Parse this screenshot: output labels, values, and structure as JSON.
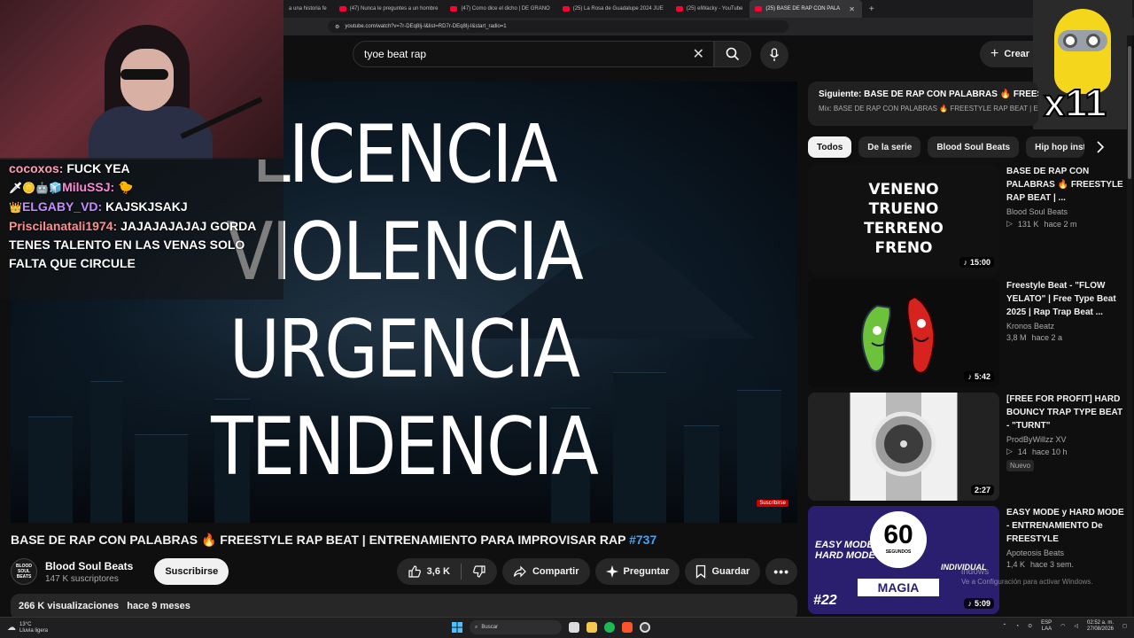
{
  "browser": {
    "tabs": [
      {
        "label": "a una historia fe"
      },
      {
        "label": "(47) Nunca le preguntes a un hombre"
      },
      {
        "label": "(47) Como dice el dicho | DE GRANO"
      },
      {
        "label": "(25) La Rosa de Guadalupe 2024 JUE"
      },
      {
        "label": "(25) elWacky - YouTube"
      },
      {
        "label": "(25) BASE DE RAP CON PALA",
        "active": true
      }
    ],
    "url": "youtube.com/watch?v=7r-DEq8Ij-I&list=RD7r-DEq8Ij-I&start_radio=1"
  },
  "stream_overlay": {
    "chat": [
      {
        "user": "cocoxos:",
        "message": "FUCK YEA",
        "prefix": ""
      },
      {
        "user": "MiluSSJ:",
        "message": "🐤",
        "prefix": "🗡🪙🤖🧊"
      },
      {
        "user": "ELGABY_VD:",
        "message": "KAJSKJSAKJ",
        "prefix": "👑"
      },
      {
        "user": "Priscilanatali1974:",
        "message": "JAJAJAJAJAJ GORDA TENES TALENTO EN LAS VENAS SOLO FALTA QUE CIRCULE",
        "prefix": ""
      }
    ],
    "emote_count": "x11"
  },
  "header": {
    "search_value": "tyoe beat rap",
    "create_label": "Crear"
  },
  "video": {
    "words": [
      "LICENCIA",
      "VIOLENCIA",
      "URGENCIA",
      "TENDENCIA"
    ],
    "subscribe_badge": "Suscribirse",
    "title": "BASE DE RAP CON PALABRAS 🔥 FREESTYLE RAP BEAT | ENTRENAMIENTO PARA IMPROVISAR RAP",
    "hashtag": "#737",
    "channel_name": "Blood Soul Beats",
    "channel_avatar_text": "BLOOD SOUL BEATS",
    "subscribers": "147 K suscriptores",
    "subscribe_label": "Suscribirse",
    "likes": "3,6 K",
    "share_label": "Compartir",
    "ask_label": "Preguntar",
    "save_label": "Guardar",
    "views": "266 K visualizaciones",
    "age": "hace 9 meses"
  },
  "sidebar": {
    "next_title": "Siguiente: BASE DE RAP CON PALABRAS 🔥 FREESTYLE",
    "next_subtitle": "Mix: BASE DE RAP CON PALABRAS 🔥 FREESTYLE RAP BEAT | EN",
    "chips": [
      "Todos",
      "De la serie",
      "Blood Soul Beats",
      "Hip hop instru"
    ],
    "recommendations": [
      {
        "title": "BASE DE RAP CON PALABRAS 🔥 FREESTYLE RAP BEAT | ...",
        "channel": "Blood Soul Beats",
        "views": "131 K",
        "age": "hace 2 m",
        "duration": "15:00",
        "thumb_words": [
          "VENENO",
          "TRUENO",
          "TERRENO",
          "FRENO"
        ],
        "badge": ""
      },
      {
        "title": "Freestyle Beat - \"FLOW YELATO\" | Free Type Beat 2025 | Rap Trap Beat ...",
        "channel": "Kronos Beatz",
        "views": "3,8 M",
        "age": "hace 2 a",
        "duration": "5:42",
        "badge": ""
      },
      {
        "title": "[FREE FOR PROFIT] HARD BOUNCY TRAP TYPE BEAT - \"TURNT\"",
        "channel": "ProdByWillzz XV",
        "views": "14",
        "age": "hace 10 h",
        "duration": "2:27",
        "badge": "Nuevo"
      },
      {
        "title": "EASY MODE y HARD MODE - ENTRENAMIENTO De FREESTYLE",
        "channel": "Apoteosis Beats",
        "views": "1,4 K",
        "age": "hace 3 sem.",
        "duration": "5:09",
        "badge": "",
        "thumb_texts": [
          "EASY MODE",
          "HARD MODE",
          "60",
          "SEGUNDOS",
          "INDIVIDUAL",
          "MAGIA",
          "#22"
        ]
      }
    ]
  },
  "taskbar": {
    "weather_temp": "13°C",
    "weather_desc": "Lluvia ligera",
    "search_label": "Buscar",
    "lang": "ESP",
    "lang_sub": "LAA",
    "time": "02:52 a. m.",
    "date": "27/08/2026"
  },
  "watermark": {
    "line1": "indows",
    "line2": "Ve a Configuración para activar Windows."
  },
  "colors": {
    "youtube_red": "#ff0033",
    "link_blue": "#3ea6ff",
    "background": "#0f0f0f"
  }
}
